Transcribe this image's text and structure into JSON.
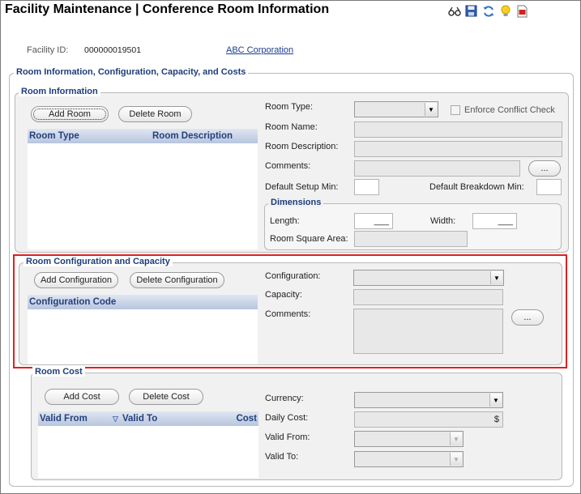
{
  "header": {
    "title": "Facility Maintenance | Conference Room Information",
    "toolbar": [
      {
        "icon": "glasses-icon"
      },
      {
        "icon": "save-icon"
      },
      {
        "icon": "refresh-icon"
      },
      {
        "icon": "lightbulb-icon"
      },
      {
        "icon": "pdf-icon"
      }
    ]
  },
  "facility": {
    "id_label": "Facility ID:",
    "id_value": "000000019501",
    "company_link": "ABC Corporation"
  },
  "main_group": {
    "title": "Room Information, Configuration, Capacity,  and Costs"
  },
  "room_info": {
    "title": "Room Information",
    "add_button": "Add Room",
    "delete_button": "Delete Room",
    "grid_headers": [
      "Room Type",
      "Room Description"
    ],
    "room_type_label": "Room Type:",
    "enforce_conflict_label": "Enforce Conflict Check",
    "room_name_label": "Room Name:",
    "room_description_label": "Room Description:",
    "comments_label": "Comments:",
    "comments_button": "...",
    "default_setup_label": "Default Setup Min:",
    "default_breakdown_label": "Default Breakdown Min:"
  },
  "dimensions": {
    "title": "Dimensions",
    "length_label": "Length:",
    "length_value": "___",
    "width_label": "Width:",
    "width_value": "___",
    "square_area_label": "Room Square Area:"
  },
  "room_config": {
    "title": "Room Configuration and Capacity",
    "add_button": "Add Configuration",
    "delete_button": "Delete Configuration",
    "grid_headers": [
      "Configuration Code"
    ],
    "configuration_label": "Configuration:",
    "capacity_label": "Capacity:",
    "comments_label": "Comments:",
    "comments_button": "..."
  },
  "room_cost": {
    "title": "Room Cost",
    "add_button": "Add Cost",
    "delete_button": "Delete Cost",
    "grid_headers": [
      "Valid From",
      "Valid To",
      "Cost"
    ],
    "currency_label": "Currency:",
    "daily_cost_label": "Daily Cost:",
    "daily_cost_suffix": "$",
    "valid_from_label": "Valid From:",
    "valid_to_label": "Valid To:"
  },
  "colors": {
    "group_title": "#1f3d7a",
    "highlight_border": "#e02020",
    "grid_header_top": "#dfe6f2",
    "grid_header_bottom": "#b7c5de"
  }
}
